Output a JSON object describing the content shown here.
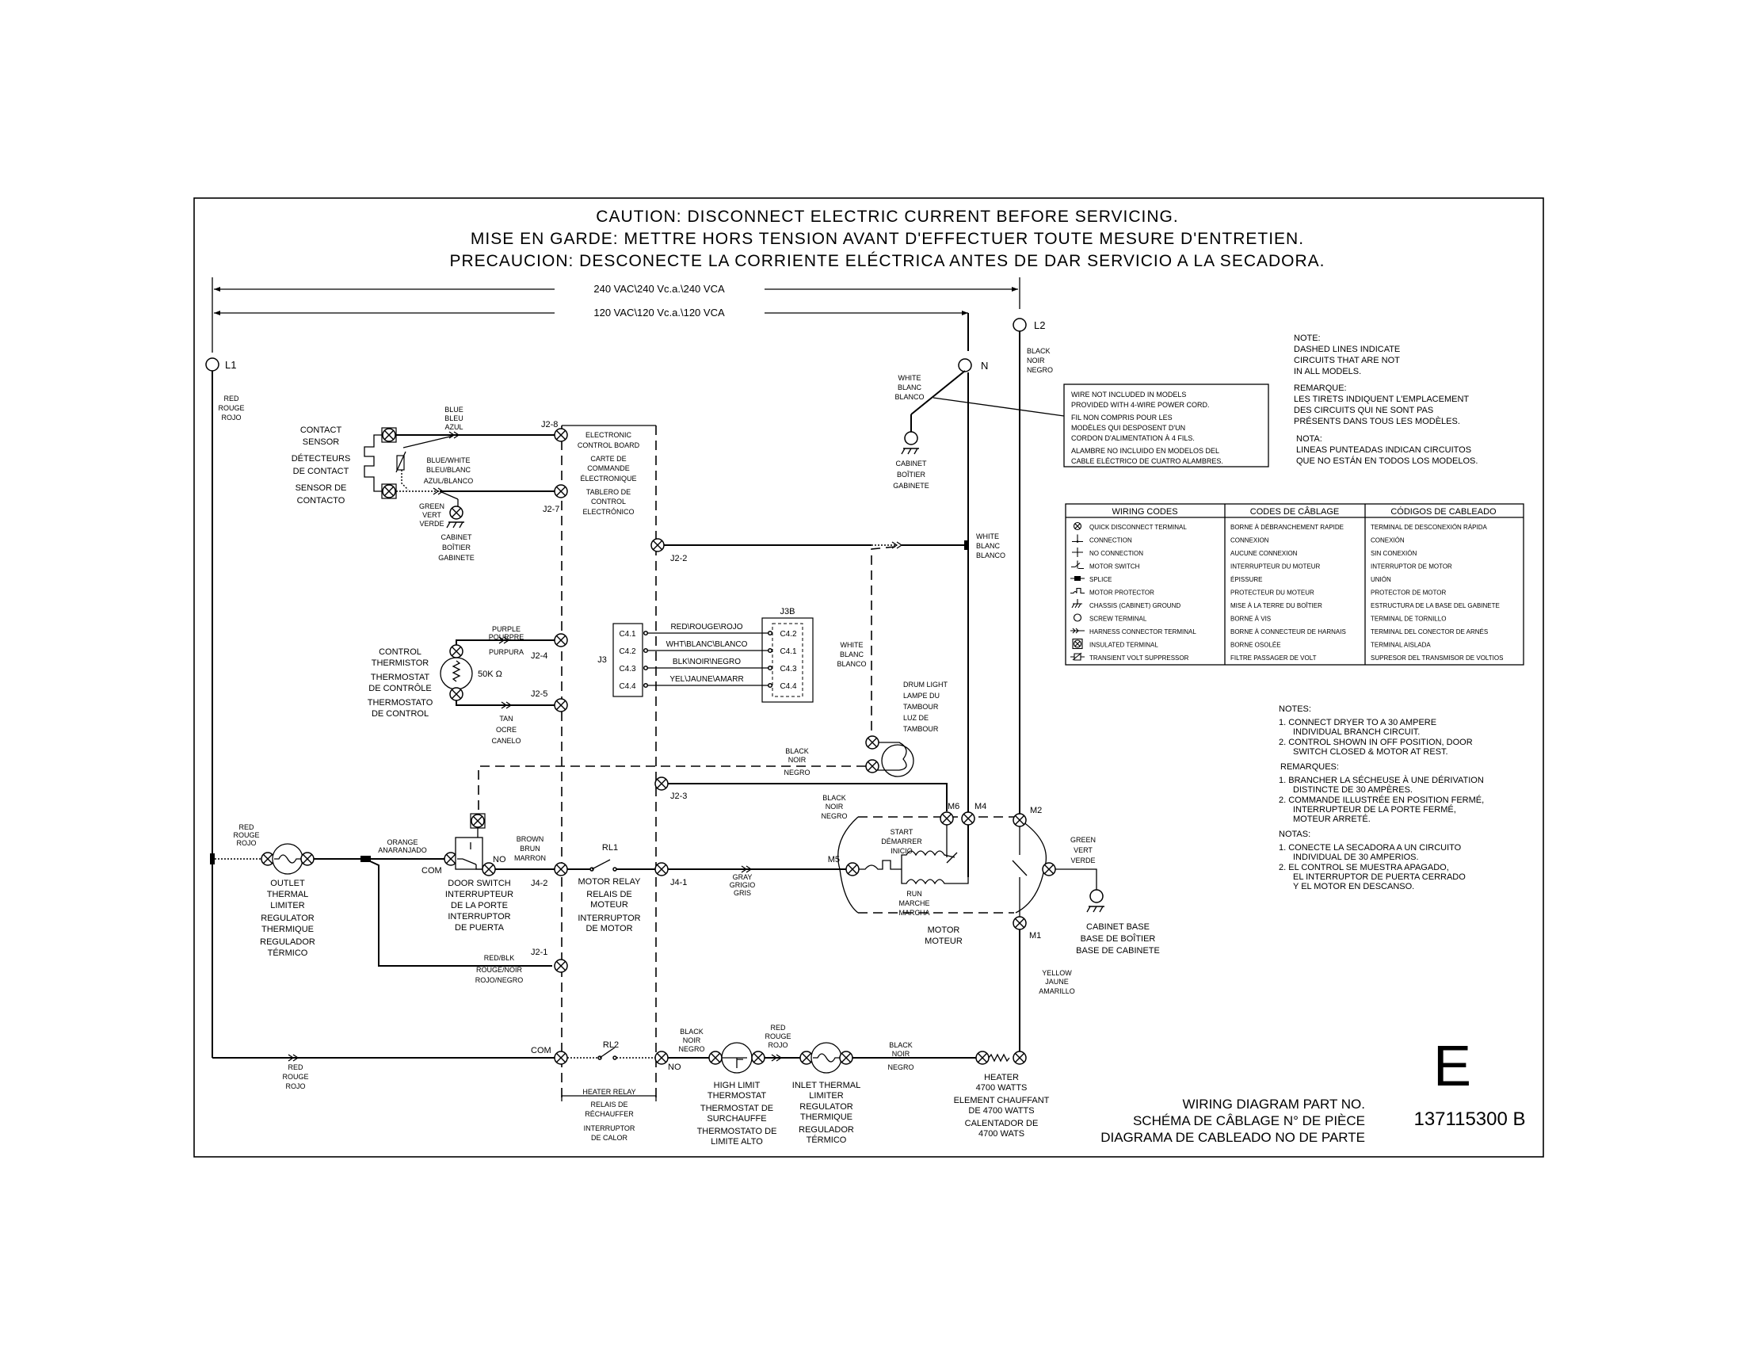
{
  "caution": {
    "en": "CAUTION: DISCONNECT ELECTRIC CURRENT BEFORE SERVICING.",
    "fr": "MISE EN GARDE: METTRE HORS TENSION AVANT D'EFFECTUER TOUTE MESURE D'ENTRETIEN.",
    "es": "PRECAUCION: DESCONECTE LA CORRIENTE ELÉCTRICA ANTES DE DAR SERVICIO A LA SECADORA."
  },
  "voltage": {
    "v240": "240 VAC\\240 Vc.a.\\240 VCA",
    "v120": "120 VAC\\120 Vc.a.\\120 VCA"
  },
  "terminals": {
    "l1": "L1",
    "l2": "L2",
    "n": "N"
  },
  "wire_colors": {
    "red": [
      "RED",
      "ROUGE",
      "ROJO"
    ],
    "black": [
      "BLACK",
      "NOIR",
      "NEGRO"
    ],
    "white": [
      "WHITE",
      "BLANC",
      "BLANCO"
    ],
    "blue": [
      "BLUE",
      "BLEU",
      "AZUL"
    ],
    "blue_white": [
      "BLUE/WHITE",
      "BLEU/BLANC",
      "AZUL/BLANCO"
    ],
    "green": [
      "GREEN",
      "VERT",
      "VERDE"
    ],
    "purple": [
      "PURPLE",
      "POURPRE",
      "PURPURA"
    ],
    "tan": [
      "TAN",
      "OCRE",
      "CANELO"
    ],
    "orange": [
      "ORANGE",
      "ANARANJADO"
    ],
    "brown": [
      "BROWN",
      "BRUN",
      "MARRON"
    ],
    "red_blk": [
      "RED/BLK",
      "ROUGE/NOIR",
      "ROJO/NEGRO"
    ],
    "gray": [
      "GRAY",
      "GRIGIO",
      "GRIS"
    ],
    "yellow": [
      "YELLOW",
      "JAUNE",
      "AMARILLO"
    ]
  },
  "components": {
    "contact_sensor": [
      "CONTACT",
      "SENSOR",
      "DÉTECTEURS",
      "DE CONTACT",
      "SENSOR DE",
      "CONTACTO"
    ],
    "cabinet": [
      "CABINET",
      "BOÎTIER",
      "GABINETE"
    ],
    "control_board": [
      "ELECTRONIC",
      "CONTROL BOARD",
      "CARTE DE",
      "COMMANDE",
      "ÉLECTRONIQUE",
      "TABLERO DE",
      "CONTROL",
      "ELECTRÓNICO"
    ],
    "thermistor": [
      "CONTROL",
      "THERMISTOR",
      "THERMOSTAT",
      "DE CONTRÔLE",
      "THERMOSTATO",
      "DE CONTROL"
    ],
    "thermistor_value": "50K Ω",
    "drum_light": [
      "DRUM LIGHT",
      "LAMPE DU",
      "TAMBOUR",
      "LUZ DE",
      "TAMBOUR"
    ],
    "outlet_limiter": [
      "OUTLET",
      "THERMAL",
      "LIMITER",
      "REGULATOR",
      "THERMIQUE",
      "REGULADOR",
      "TÉRMICO"
    ],
    "door_switch": [
      "DOOR SWITCH",
      "INTERRUPTEUR",
      "DE LA PORTE",
      "INTERRUPTOR",
      "DE PUERTA"
    ],
    "motor_relay": [
      "MOTOR RELAY",
      "RELAIS DE",
      "MOTEUR",
      "INTERRUPTOR",
      "DE MOTOR"
    ],
    "motor": [
      "MOTOR",
      "MOTEUR"
    ],
    "start": [
      "START",
      "DÉMARRER",
      "INICIO"
    ],
    "run": [
      "RUN",
      "MARCHE",
      "MARCHA"
    ],
    "cabinet_base": [
      "CABINET BASE",
      "BASE DE BOÎTIER",
      "BASE DE CABINETE"
    ],
    "heater_relay": [
      "HEATER RELAY",
      "RELAIS DE",
      "RÉCHAUFFER",
      "INTERRUPTOR",
      "DE CALOR"
    ],
    "high_limit": [
      "HIGH LIMIT",
      "THERMOSTAT",
      "THERMOSTAT DE",
      "SURCHAUFFE",
      "THERMOSTATO DE",
      "LIMITE ALTO"
    ],
    "inlet_limiter": [
      "INLET THERMAL",
      "LIMITER",
      "REGULATOR",
      "THERMIQUE",
      "REGULADOR",
      "TÉRMICO"
    ],
    "heater": [
      "HEATER",
      "4700 WATTS",
      "ELEMENT CHAUFFANT",
      "DE 4700 WATTS",
      "CALENTADOR DE",
      "4700 WATS"
    ]
  },
  "pins": {
    "j2_8": "J2-8",
    "j2_7": "J2-7",
    "j2_2": "J2-2",
    "j2_4": "J2-4",
    "j2_5": "J2-5",
    "j2_3": "J2-3",
    "j4_2": "J4-2",
    "j4_1": "J4-1",
    "j2_1": "J2-1",
    "com": "COM",
    "no": "NO",
    "rl1": "RL1",
    "rl2": "RL2",
    "j3": "J3",
    "j3b": "J3B",
    "m1": "M1",
    "m2": "M2",
    "m4": "M4",
    "m5": "M5",
    "m6": "M6"
  },
  "harness": {
    "left": [
      "C4.1",
      "C4.2",
      "C4.3",
      "C4.4"
    ],
    "right": [
      "C4.2",
      "C4.1",
      "C4.3",
      "C4.4"
    ],
    "wires": [
      "RED\\ROUGE\\ROJO",
      "WHT\\BLANC\\BLANCO",
      "BLK\\NOIR\\NEGRO",
      "YEL\\JAUNE\\AMARR"
    ]
  },
  "four_wire_note": [
    "WIRE NOT INCLUDED IN MODELS",
    "PROVIDED WITH 4-WIRE POWER CORD.",
    "FIL NON COMPRIS POUR LES",
    "MODÈLES QUI DESPOSENT D'UN",
    "CORDON D'ALIMENTATION À 4 FILS.",
    "ALAMBRE NO INCLUIDO EN MODELOS DEL",
    "CABLE ELÉCTRICO DE CUATRO ALAMBRES."
  ],
  "dashed_note": [
    "NOTE:",
    "DASHED LINES INDICATE",
    "CIRCUITS THAT ARE NOT",
    "IN ALL MODELS.",
    "REMARQUE:",
    "LES TIRETS INDIQUENT L'EMPLACEMENT",
    "DES CIRCUITS QUI NE SONT PAS",
    "PRÉSENTS DANS TOUS LES MODÈLES.",
    "NOTA:",
    "LINEAS PUNTEADAS INDICAN CIRCUITOS",
    "QUE NO ESTÁN EN TODOS LOS MODELOS."
  ],
  "legend": {
    "headers": [
      "WIRING CODES",
      "CODES DE CÂBLAGE",
      "CÓDIGOS DE CABLEADO"
    ],
    "rows": [
      {
        "icon": "quick-disconnect-terminal",
        "en": "QUICK DISCONNECT TERMINAL",
        "fr": "BORNE À DÉBRANCHEMENT RAPIDE",
        "es": "TERMINAL DE DESCONEXIÓN RÁPIDA"
      },
      {
        "icon": "connection",
        "en": "CONNECTION",
        "fr": "CONNEXION",
        "es": "CONEXIÓN"
      },
      {
        "icon": "no-connection",
        "en": "NO CONNECTION",
        "fr": "AUCUNE CONNEXION",
        "es": "SIN CONEXIÓN"
      },
      {
        "icon": "motor-switch",
        "en": "MOTOR SWITCH",
        "fr": "INTERRUPTEUR DU MOTEUR",
        "es": "INTERRUPTOR DE MOTOR"
      },
      {
        "icon": "splice",
        "en": "SPLICE",
        "fr": "ÉPISSURE",
        "es": "UNIÓN"
      },
      {
        "icon": "motor-protector",
        "en": "MOTOR PROTECTOR",
        "fr": "PROTECTEUR DU MOTEUR",
        "es": "PROTECTOR DE MOTOR"
      },
      {
        "icon": "chassis-ground",
        "en": "CHASSIS (CABINET) GROUND",
        "fr": "MISE À LA TERRE DU BOÎTIER",
        "es": "ESTRUCTURA DE LA BASE DEL GABINETE"
      },
      {
        "icon": "screw-terminal",
        "en": "SCREW TERMINAL",
        "fr": "BORNE À VIS",
        "es": "TERMINAL DE TORNILLO"
      },
      {
        "icon": "harness-connector",
        "en": "HARNESS CONNECTOR TERMINAL",
        "fr": "BORNE À CONNECTEUR DE HARNAIS",
        "es": "TERMINAL DEL CONECTOR DE ARNÉS"
      },
      {
        "icon": "insulated-terminal",
        "en": "INSULATED TERMINAL",
        "fr": "BORNE OSOLÉE",
        "es": "TERMINAL AISLADA"
      },
      {
        "icon": "transient-volt-suppressor",
        "en": "TRANSIENT VOLT SUPPRESSOR",
        "fr": "FILTRE PASSAGER DE VOLT",
        "es": "SUPRESOR DEL TRANSMISOR DE VOLTIOS"
      }
    ]
  },
  "notes": {
    "en_title": "NOTES:",
    "en": [
      "1. CONNECT DRYER TO A 30 AMPERE",
      "INDIVIDUAL BRANCH CIRCUIT.",
      "2. CONTROL SHOWN IN OFF POSITION, DOOR",
      "SWITCH CLOSED & MOTOR AT REST."
    ],
    "fr_title": "REMARQUES:",
    "fr": [
      "1. BRANCHER LA SÉCHEUSE À UNE DÉRIVATION",
      "DISTINCTE DE 30 AMPÈRES.",
      "2. COMMANDE ILLUSTRÉE EN POSITION FERMÉ,",
      "INTERRUPTEUR DE LA PORTE FERMÉ,",
      "MOTEUR ARRETÉ."
    ],
    "es_title": "NOTAS:",
    "es": [
      "1. CONECTE LA SECADORA A UN CIRCUITO",
      "INDIVIDUAL DE 30 AMPERIOS.",
      "2. EL CONTROL SE MUESTRA APAGADO,",
      "EL INTERRUPTOR DE PUERTA CERRADO",
      "Y EL MOTOR EN DESCANSO."
    ]
  },
  "title_block": {
    "revision_letter": "E",
    "labels": [
      "WIRING DIAGRAM PART NO.",
      "SCHÉMA DE CÂBLAGE N° DE PIÈCE",
      "DIAGRAMA DE CABLEADO NO DE PARTE"
    ],
    "part_number": "137115300 B"
  }
}
